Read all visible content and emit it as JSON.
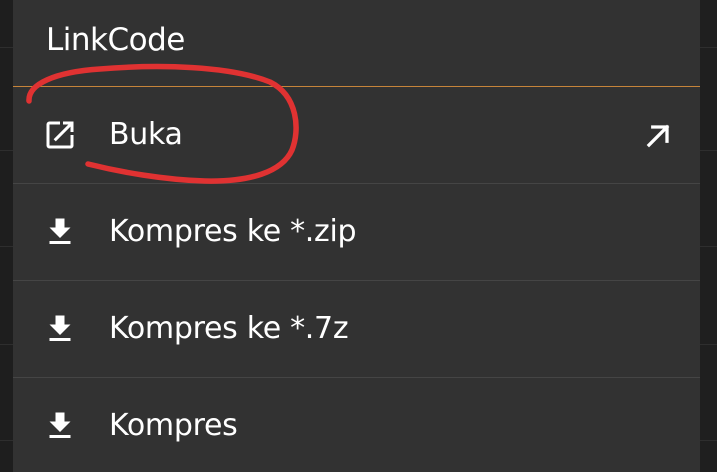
{
  "dialog": {
    "title": "LinkCode",
    "accent_color": "#c6843a",
    "background_color": "#323232",
    "items": [
      {
        "label": "Buka",
        "icon": "open-in-new-icon",
        "trailing_icon": "arrow-up-right-icon"
      },
      {
        "label": "Kompres ke *.zip",
        "icon": "download-icon"
      },
      {
        "label": "Kompres ke *.7z",
        "icon": "download-icon"
      },
      {
        "label": "Kompres",
        "icon": "download-icon"
      }
    ]
  },
  "annotation": {
    "color": "#e03232"
  }
}
